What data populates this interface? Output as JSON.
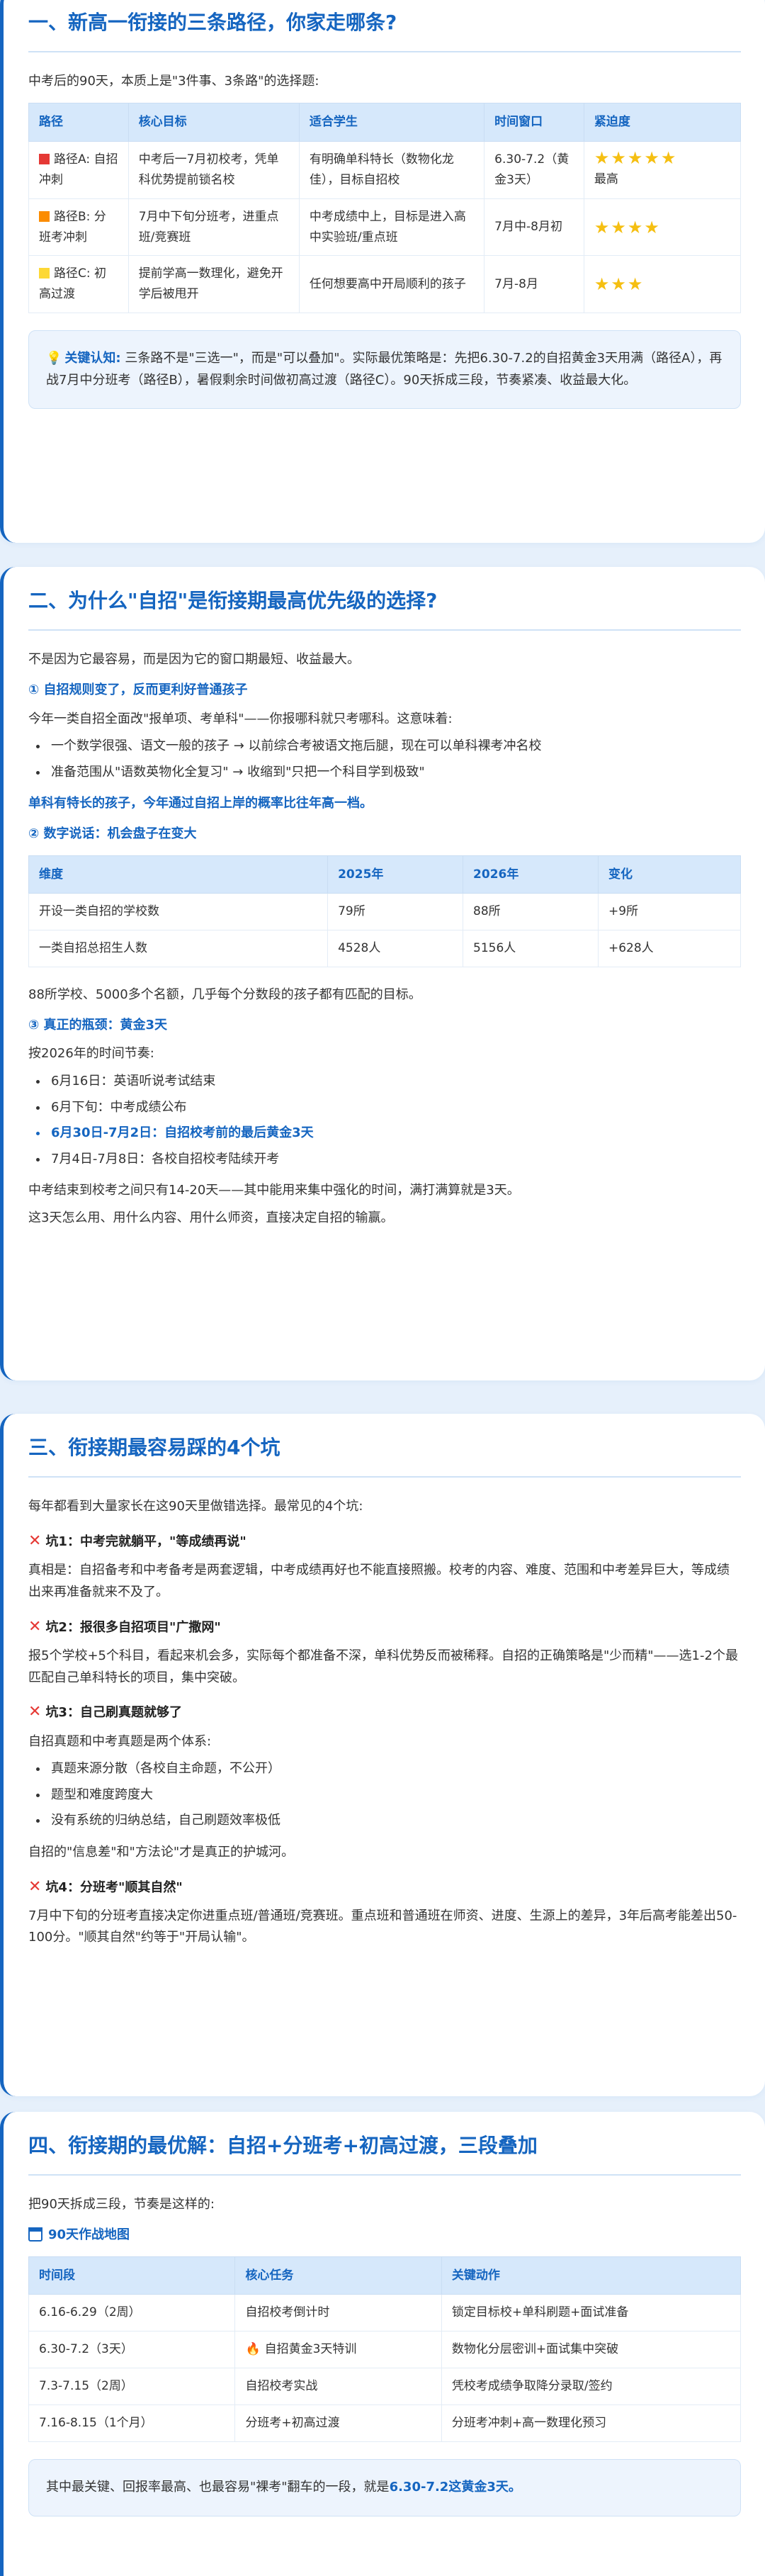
{
  "s1": {
    "title": "一、新高一衔接的三条路径，你家走哪条?",
    "intro": "中考后的90天，本质上是\"3件事、3条路\"的选择题:",
    "headers": [
      "路径",
      "核心目标",
      "适合学生",
      "时间窗口",
      "紧迫度"
    ],
    "rows": [
      {
        "path": "路径A: 自招冲刺",
        "color": "#e53935",
        "goal": "中考后一7月初校考，凭单科优势提前锁名校",
        "fit": "有明确单科特长（数物化龙佳），目标自招校",
        "window": "6.30-7.2（黄金3天）",
        "stars": 5,
        "extra": "最高"
      },
      {
        "path": "路径B: 分班考冲刺",
        "color": "#fb8c00",
        "goal": "7月中下旬分班考，进重点班/竞赛班",
        "fit": "中考成绩中上，目标是进入高中实验班/重点班",
        "window": "7月中-8月初",
        "stars": 4,
        "extra": ""
      },
      {
        "path": "路径C: 初高过渡",
        "color": "#fdd835",
        "goal": "提前学高一数理化，避免开学后被甩开",
        "fit": "任何想要高中开局顺利的孩子",
        "window": "7月-8月",
        "stars": 3,
        "extra": ""
      }
    ],
    "note_label": "关键认知:",
    "note_text1": "三条路不是\"三选一\"，而是\"可以叠加\"。实际最优策略是：先把6.30-7.2的自招黄金3天用满（路径A），再战7月中分班考（路径B），暑假剩余时间做初高过渡（路径C）。",
    "note_text2": "90天拆成三段，节奏紧凑、收益最大化。"
  },
  "s2": {
    "title": "二、为什么\"自招\"是衔接期最高优先级的选择?",
    "intro": "不是因为它最容易，而是因为它的窗口期最短、收益最大。",
    "h1": "① 自招规则变了，反而更利好普通孩子",
    "p1": "今年一类自招全面改\"报单项、考单科\"——你报哪科就只考哪科。这意味着:",
    "bullets1": [
      "一个数学很强、语文一般的孩子 → 以前综合考被语文拖后腿，现在可以单科裸考冲名校",
      "准备范围从\"语数英物化全复习\" → 收缩到\"只把一个科目学到极致\""
    ],
    "bold1": "单科有特长的孩子，今年通过自招上岸的概率比往年高一档。",
    "h2": "② 数字说话：机会盘子在变大",
    "headers": [
      "维度",
      "2025年",
      "2026年",
      "变化"
    ],
    "rows": [
      [
        "开设一类自招的学校数",
        "79所",
        "88所",
        "+9所"
      ],
      [
        "一类自招总招生人数",
        "4528人",
        "5156人",
        "+628人"
      ]
    ],
    "p2": "88所学校、5000多个名额，几乎每个分数段的孩子都有匹配的目标。",
    "h3": "③ 真正的瓶颈：黄金3天",
    "p3": "按2026年的时间节奏:",
    "bullets2": [
      "6月16日：英语听说考试结束",
      "6月下旬：中考成绩公布",
      "6月30日-7月2日：自招校考前的最后黄金3天",
      "7月4日-7月8日：各校自招校考陆续开考"
    ],
    "p4": "中考结束到校考之间只有14-20天——其中能用来集中强化的时间，满打满算就是3天。",
    "p5": "这3天怎么用、用什么内容、用什么师资，直接决定自招的输赢。"
  },
  "s3": {
    "title": "三、衔接期最容易踩的4个坑",
    "intro": "每年都看到大量家长在这90天里做错选择。最常见的4个坑:",
    "pit1_title": "坑1：中考完就躺平，\"等成绩再说\"",
    "pit1_text": "真相是：自招备考和中考备考是两套逻辑，中考成绩再好也不能直接照搬。校考的内容、难度、范围和中考差异巨大，等成绩出来再准备就来不及了。",
    "pit2_title": "坑2：报很多自招项目\"广撒网\"",
    "pit2_text": "报5个学校+5个科目，看起来机会多，实际每个都准备不深，单科优势反而被稀释。自招的正确策略是\"少而精\"——选1-2个最匹配自己单科特长的项目，集中突破。",
    "pit3_title": "坑3：自己刷真题就够了",
    "pit3_text": "自招真题和中考真题是两个体系:",
    "pit3_bullets": [
      "真题来源分散（各校自主命题，不公开）",
      "题型和难度跨度大",
      "没有系统的归纳总结，自己刷题效率极低"
    ],
    "pit3_after": "自招的\"信息差\"和\"方法论\"才是真正的护城河。",
    "pit4_title": "坑4：分班考\"顺其自然\"",
    "pit4_text": "7月中下旬的分班考直接决定你进重点班/普通班/竞赛班。重点班和普通班在师资、进度、生源上的差异，3年后高考能差出50-100分。\"顺其自然\"约等于\"开局认输\"。"
  },
  "s4": {
    "title": "四、衔接期的最优解：自招+分班考+初高过渡，三段叠加",
    "intro": "把90天拆成三段，节奏是这样的:",
    "map_title": "90天作战地图",
    "headers": [
      "时间段",
      "核心任务",
      "关键动作"
    ],
    "rows": [
      [
        "6.16-6.29（2周）",
        "自招校考倒计时",
        "锁定目标校+单科刷题+面试准备"
      ],
      [
        "6.30-7.2（3天）",
        "自招黄金3天特训",
        "数物化分层密训+面试集中突破"
      ],
      [
        "7.3-7.15（2周）",
        "自招校考实战",
        "凭校考成绩争取降分录取/签约"
      ],
      [
        "7.16-8.15（1个月）",
        "分班考+初高过渡",
        "分班考冲刺+高一数理化预习"
      ]
    ],
    "note_text": "其中最关键、回报率最高、也最容易\"裸考\"翻车的一段，就是",
    "note_bold": "6.30-7.2这黄金3天。"
  }
}
